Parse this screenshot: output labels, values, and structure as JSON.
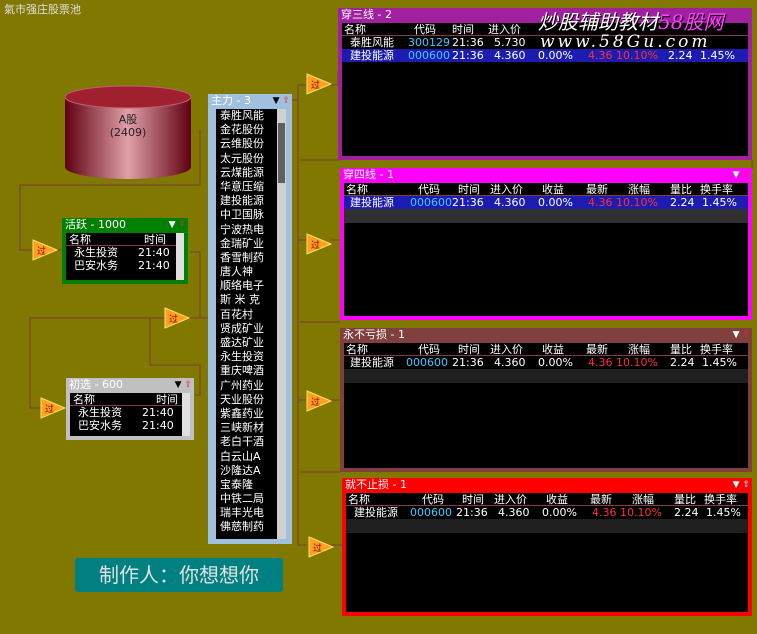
{
  "app": {
    "title": "氣市强庄股票池"
  },
  "cylinder": {
    "label": "A股",
    "count": "(2409)"
  },
  "arrow_label": "过",
  "huoyue": {
    "title": "活跃 - 1000",
    "columns": [
      "名称",
      "时间"
    ],
    "rows": [
      [
        "永生投资",
        "21:40"
      ],
      [
        "巴安水务",
        "21:40"
      ]
    ]
  },
  "chuxuan": {
    "title": "初选 - 600",
    "columns": [
      "名称",
      "时间"
    ],
    "rows": [
      [
        "永生投资",
        "21:40"
      ],
      [
        "巴安水务",
        "21:40"
      ]
    ]
  },
  "zhuli": {
    "title": "主力 - 3",
    "items": [
      "泰胜风能",
      "金花股份",
      "云维股份",
      "太元股份",
      "云煤能源",
      "华意压缩",
      "建投能源",
      "中卫国脉",
      "宁波热电",
      "金瑞矿业",
      "香雪制药",
      "唐人神",
      "顺络电子",
      "斯 米 克",
      "百花村",
      "贤成矿业",
      "盛达矿业",
      "永生投资",
      "重庆啤酒",
      "广州药业",
      "天业股份",
      "紫鑫药业",
      "三峡新材",
      "老白干酒",
      "白云山A",
      "沙隆达A",
      "宝泰隆",
      "中铁二局",
      "瑞丰光电",
      "佛慈制药"
    ]
  },
  "table_columns": [
    "名称",
    "代码",
    "时间",
    "进入价",
    "收益",
    "最新",
    "涨幅",
    "量比",
    "换手率"
  ],
  "chuansan": {
    "title": "穿三线 - 2",
    "rows": [
      [
        "泰胜风能",
        "300129",
        "21:36",
        "5.730",
        "",
        "",
        "",
        "",
        ""
      ],
      [
        "建投能源",
        "000600",
        "21:36",
        "4.360",
        "0.00%",
        "4.36",
        "10.10%",
        "2.24",
        "1.45%"
      ]
    ]
  },
  "chuansi": {
    "title": "穿四线 - 1",
    "rows": [
      [
        "建投能源",
        "000600",
        "21:36",
        "4.360",
        "0.00%",
        "4.36",
        "10.10%",
        "2.24",
        "1.45%"
      ]
    ]
  },
  "yongbu": {
    "title": "永不亏损 - 1",
    "rows": [
      [
        "建投能源",
        "000600",
        "21:36",
        "4.360",
        "0.00%",
        "4.36",
        "10.10%",
        "2.24",
        "1.45%"
      ]
    ]
  },
  "jiubu": {
    "title": "就不止损 - 1",
    "rows": [
      [
        "建投能源",
        "000600",
        "21:36",
        "4.360",
        "0.00%",
        "4.36",
        "10.10%",
        "2.24",
        "1.45%"
      ]
    ]
  },
  "maker": "制作人：你想想你",
  "watermark": {
    "line1": "炒股辅助教材",
    "line1_num": "58股网",
    "line2": "www.58Gu.com"
  },
  "colors": {
    "background": "#807800",
    "chuansan": "#a020a0",
    "chuansi": "#ff00ff",
    "yongbu": "#804040",
    "jiubu": "#ff0000",
    "huoyue": "#008000",
    "chuxuan": "#c0c0c0",
    "zhuli": "#a0c0e0"
  }
}
